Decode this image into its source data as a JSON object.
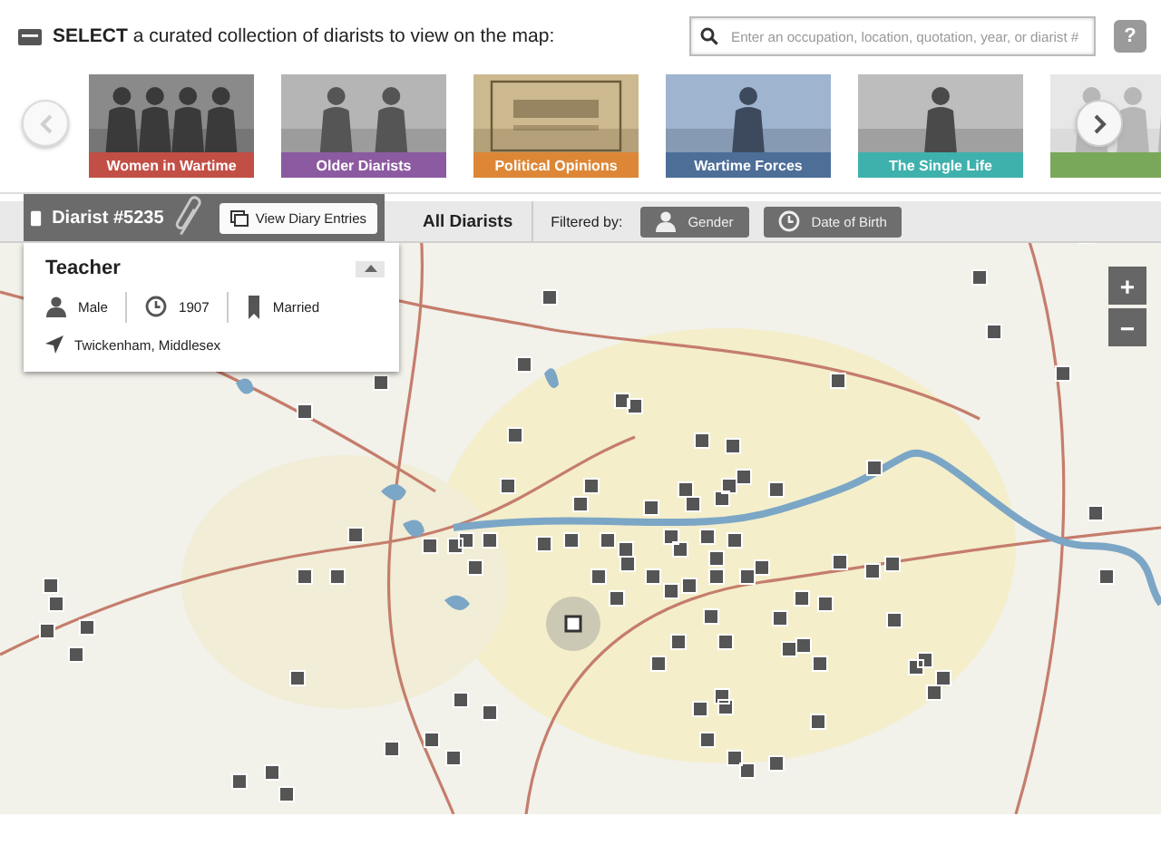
{
  "header": {
    "prompt": "**SELECT** a curated collection of diarists to view on the map:",
    "search_placeholder": "Enter an occupation, location, quotation, year, or diarist #",
    "help": "?"
  },
  "collections": [
    {
      "label": "Women in Wartime",
      "color": "#c24f45"
    },
    {
      "label": "Older Diarists",
      "color": "#8c5aa0"
    },
    {
      "label": "Political Opinions",
      "color": "#dd8736"
    },
    {
      "label": "Wartime Forces",
      "color": "#4d6e97"
    },
    {
      "label": "The Single Life",
      "color": "#3fb1ad"
    },
    {
      "color": "#7aa85a"
    }
  ],
  "toolbar": {
    "diarist": "Diarist #5235",
    "view_button": "View Diary Entries",
    "scope": "All Diarists",
    "filter_label": "Filtered by:",
    "filters": [
      {
        "kind": "person",
        "label": "Gender"
      },
      {
        "kind": "clock",
        "label": "Date of Birth"
      }
    ]
  },
  "diarist_card": {
    "title": "Teacher",
    "expanded": true,
    "facts": [
      {
        "kind": "person",
        "text": "Male"
      },
      {
        "kind": "clock",
        "text": "1907"
      },
      {
        "kind": "bookmark",
        "text": "Married"
      }
    ],
    "location": "Twickenham, Middlesex"
  },
  "map_zoom": [
    "+",
    "−"
  ]
}
